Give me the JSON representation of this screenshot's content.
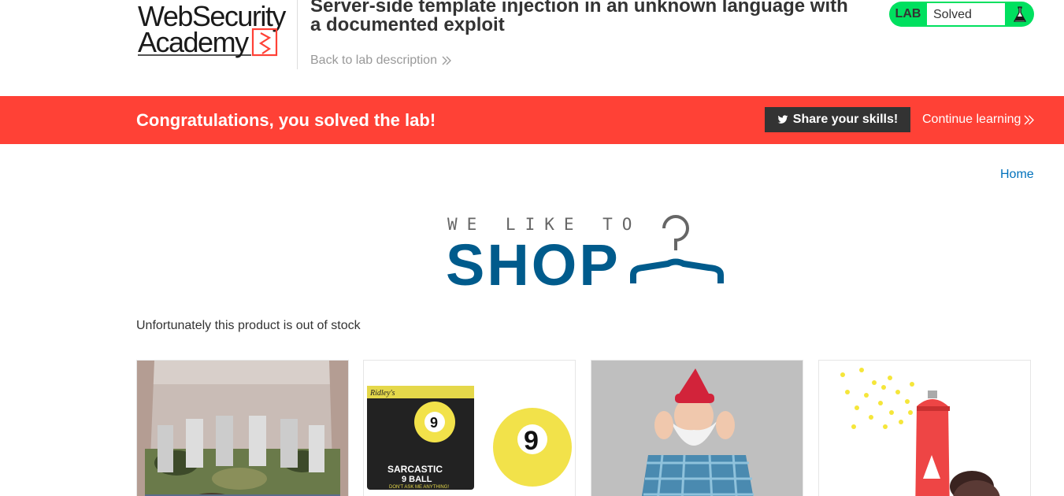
{
  "header": {
    "logo_line1": "WebSecurity",
    "logo_line2": "Academy",
    "lab_title": "Server-side template injection in an unknown language with a documented exploit",
    "back_link": "Back to lab description",
    "lab_status": {
      "label": "LAB",
      "state": "Solved",
      "accent_color": "#00e05f"
    }
  },
  "banner": {
    "message": "Congratulations, you solved the lab!",
    "share_button": "Share your skills!",
    "continue_link": "Continue learning",
    "color": "#ff4136"
  },
  "nav": {
    "home_link": "Home"
  },
  "shop_logo": {
    "tagline": "WE LIKE TO",
    "word": "SHOP",
    "icon": "hanger-icon",
    "color": "#005b8c"
  },
  "content": {
    "stock_message": "Unfortunately this product is out of stock"
  },
  "products": [
    {
      "image": "beer-belt-photo"
    },
    {
      "image": "sarcastic-9-ball-photo",
      "box_text": [
        "Ridley's",
        "SARCASTIC",
        "9 BALL",
        "DON'T ASK ME ANYTHING!"
      ]
    },
    {
      "image": "gnome-costume-photo"
    },
    {
      "image": "spray-can-photo"
    }
  ]
}
